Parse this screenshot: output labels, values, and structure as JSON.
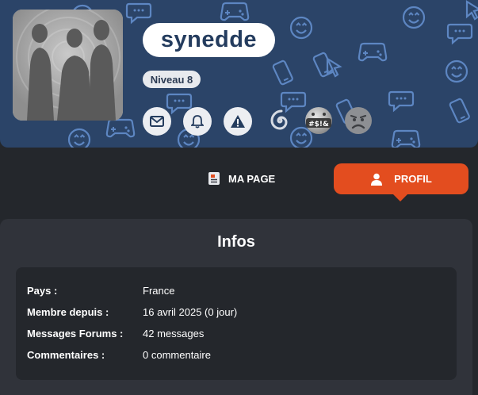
{
  "profile": {
    "username": "synedde",
    "level": "Niveau 8"
  },
  "actions": [
    {
      "name": "message",
      "icon": "envelope-icon"
    },
    {
      "name": "notifications",
      "icon": "bell-icon"
    },
    {
      "name": "report",
      "icon": "warning-icon"
    }
  ],
  "badges": [
    {
      "icon": "spiral-badge-icon"
    },
    {
      "icon": "swearing-face-badge-icon",
      "text": "#$!&"
    },
    {
      "icon": "sad-face-badge-icon"
    }
  ],
  "tabs": {
    "mapage_label": "MA PAGE",
    "profil_label": "PROFIL",
    "active": "profil"
  },
  "infos": {
    "title": "Infos",
    "rows": [
      {
        "label": "Pays :",
        "value": "France"
      },
      {
        "label": "Membre depuis :",
        "value": "16 avril 2025 (0 jour)"
      },
      {
        "label": "Messages Forums :",
        "value": "42 messages"
      },
      {
        "label": "Commentaires :",
        "value": "0 commentaire"
      }
    ]
  },
  "colors": {
    "banner": "#2b4468",
    "accent": "#e34d1f",
    "background": "#24272c",
    "card": "#30333a"
  }
}
